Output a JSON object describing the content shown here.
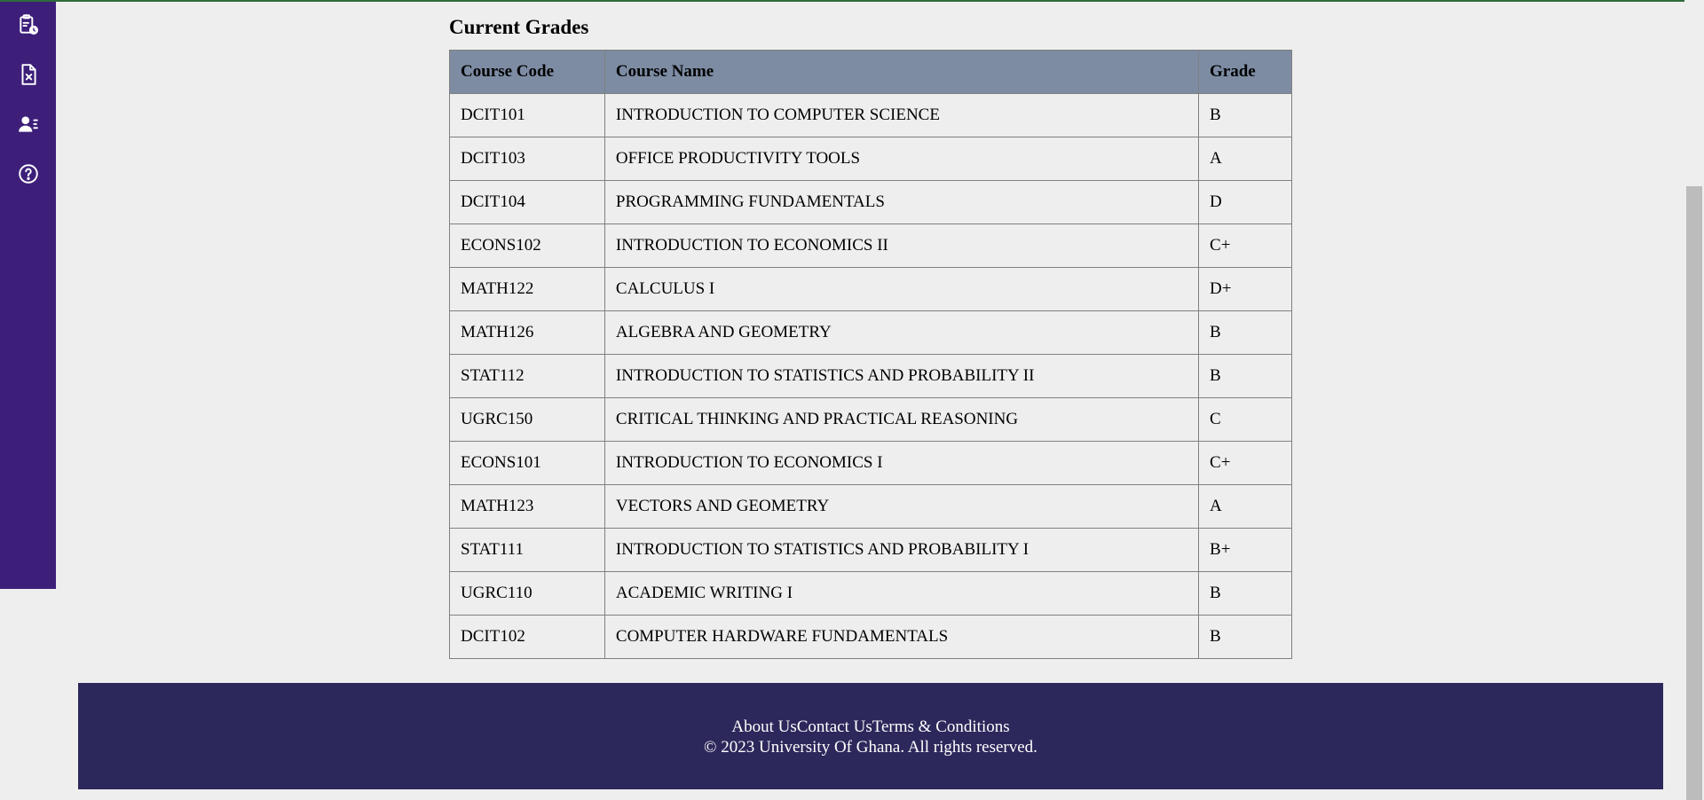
{
  "sidebar": {
    "items": [
      {
        "icon": "clipboard-clock-icon"
      },
      {
        "icon": "file-x-icon"
      },
      {
        "icon": "user-list-icon"
      },
      {
        "icon": "help-circle-icon"
      }
    ]
  },
  "grades": {
    "title": "Current Grades",
    "headers": {
      "code": "Course Code",
      "name": "Course Name",
      "grade": "Grade"
    },
    "rows": [
      {
        "code": "DCIT101",
        "name": "INTRODUCTION TO COMPUTER SCIENCE",
        "grade": "B"
      },
      {
        "code": "DCIT103",
        "name": "OFFICE PRODUCTIVITY TOOLS",
        "grade": "A"
      },
      {
        "code": "DCIT104",
        "name": "PROGRAMMING FUNDAMENTALS",
        "grade": "D"
      },
      {
        "code": "ECONS102",
        "name": "INTRODUCTION TO ECONOMICS II",
        "grade": "C+"
      },
      {
        "code": "MATH122",
        "name": "CALCULUS I",
        "grade": "D+"
      },
      {
        "code": "MATH126",
        "name": "ALGEBRA AND GEOMETRY",
        "grade": "B"
      },
      {
        "code": "STAT112",
        "name": "INTRODUCTION TO STATISTICS AND PROBABILITY II",
        "grade": "B"
      },
      {
        "code": "UGRC150",
        "name": "CRITICAL THINKING AND PRACTICAL REASONING",
        "grade": "C"
      },
      {
        "code": "ECONS101",
        "name": "INTRODUCTION TO ECONOMICS I",
        "grade": "C+"
      },
      {
        "code": "MATH123",
        "name": "VECTORS AND GEOMETRY",
        "grade": "A"
      },
      {
        "code": "STAT111",
        "name": "INTRODUCTION TO STATISTICS AND PROBABILITY I",
        "grade": "B+"
      },
      {
        "code": "UGRC110",
        "name": "ACADEMIC WRITING I",
        "grade": "B"
      },
      {
        "code": "DCIT102",
        "name": "COMPUTER HARDWARE FUNDAMENTALS",
        "grade": "B"
      }
    ]
  },
  "footer": {
    "links": [
      "About Us",
      "Contact Us",
      "Terms & Conditions"
    ],
    "copyright": "© 2023 University Of Ghana. All rights reserved."
  },
  "colors": {
    "sidebar": "#3d1f7a",
    "table_header": "#7d8ca3",
    "footer": "#2d285b",
    "page_background": "#eeeeee"
  }
}
